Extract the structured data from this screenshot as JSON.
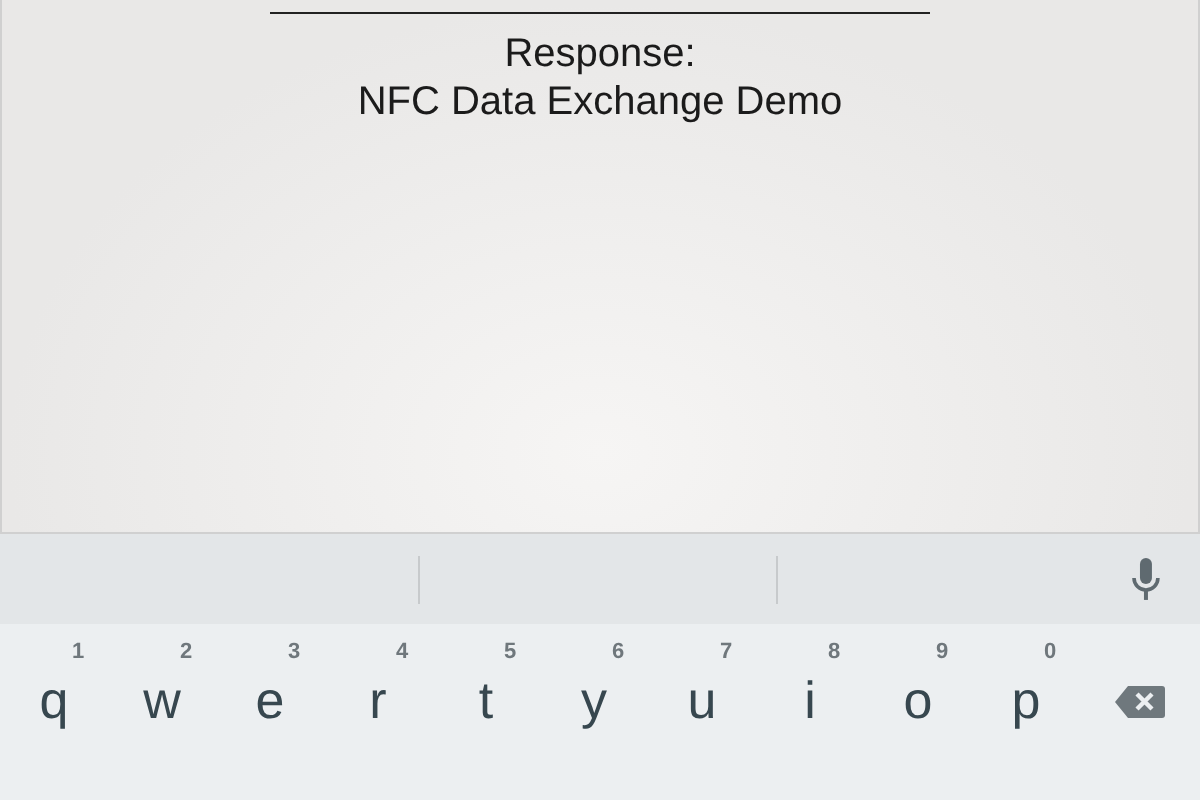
{
  "response": {
    "label": "Response:",
    "value": "NFC Data Exchange Demo"
  },
  "keyboard": {
    "keys": [
      {
        "letter": "q",
        "hint": "1"
      },
      {
        "letter": "w",
        "hint": "2"
      },
      {
        "letter": "e",
        "hint": "3"
      },
      {
        "letter": "r",
        "hint": "4"
      },
      {
        "letter": "t",
        "hint": "5"
      },
      {
        "letter": "y",
        "hint": "6"
      },
      {
        "letter": "u",
        "hint": "7"
      },
      {
        "letter": "i",
        "hint": "8"
      },
      {
        "letter": "o",
        "hint": "9"
      },
      {
        "letter": "p",
        "hint": "0"
      }
    ]
  }
}
